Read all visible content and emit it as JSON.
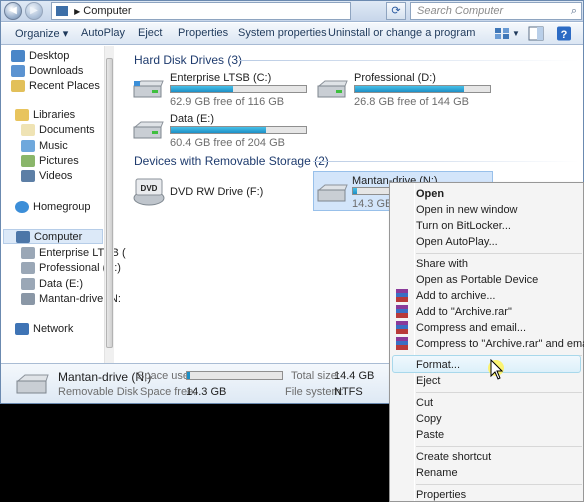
{
  "address": {
    "path": "Computer",
    "arrow": "▶",
    "search_placeholder": "Search Computer"
  },
  "toolbar": {
    "organize": "Organize ▾",
    "autoplay": "AutoPlay",
    "eject": "Eject",
    "properties": "Properties",
    "system_properties": "System properties",
    "uninstall": "Uninstall or change a program"
  },
  "sidebar": {
    "favorites": [
      "Desktop",
      "Downloads",
      "Recent Places"
    ],
    "libraries": "Libraries",
    "library_items": [
      "Documents",
      "Music",
      "Pictures",
      "Videos"
    ],
    "homegroup": "Homegroup",
    "computer": "Computer",
    "computer_items": [
      "Enterprise LTSB (",
      "Professional (D:)",
      "Data (E:)",
      "Mantan-drive (N:"
    ],
    "network": "Network"
  },
  "main": {
    "hdd_heading": "Hard Disk Drives (3)",
    "removable_heading": "Devices with Removable Storage (2)",
    "drives": [
      {
        "name": "Enterprise LTSB (C:)",
        "free": "62.9 GB free of 116 GB",
        "used_fraction": 0.46
      },
      {
        "name": "Professional (D:)",
        "free": "26.8 GB free of 144 GB",
        "used_fraction": 0.81
      },
      {
        "name": "Data (E:)",
        "free": "60.4 GB free of 204 GB",
        "used_fraction": 0.7
      }
    ],
    "dvd": {
      "name": "DVD RW Drive (F:)"
    },
    "usb": {
      "name": "Mantan-drive (N:)",
      "free": "14.3 GB fre",
      "used_fraction": 0.03
    }
  },
  "details": {
    "name": "Mantan-drive (N:)",
    "type": "Removable Disk",
    "space_used_label": "Space used:",
    "space_free_label": "Space free:",
    "space_free": "14.3 GB",
    "total_size_label": "Total size:",
    "total_size": "14.4 GB",
    "file_system_label": "File system:",
    "file_system": "NTFS",
    "used_fraction": 0.03
  },
  "context_menu": {
    "open": "Open",
    "open_new_window": "Open in new window",
    "bitlocker": "Turn on BitLocker...",
    "autoplay": "Open AutoPlay...",
    "share_with": "Share with",
    "portable": "Open as Portable Device",
    "add_archive": "Add to archive...",
    "add_rar": "Add to \"Archive.rar\"",
    "compress_email": "Compress and email...",
    "compress_rar_email": "Compress to \"Archive.rar\" and email",
    "format": "Format...",
    "eject": "Eject",
    "cut": "Cut",
    "copy": "Copy",
    "paste": "Paste",
    "create_shortcut": "Create shortcut",
    "rename": "Rename",
    "properties": "Properties"
  }
}
